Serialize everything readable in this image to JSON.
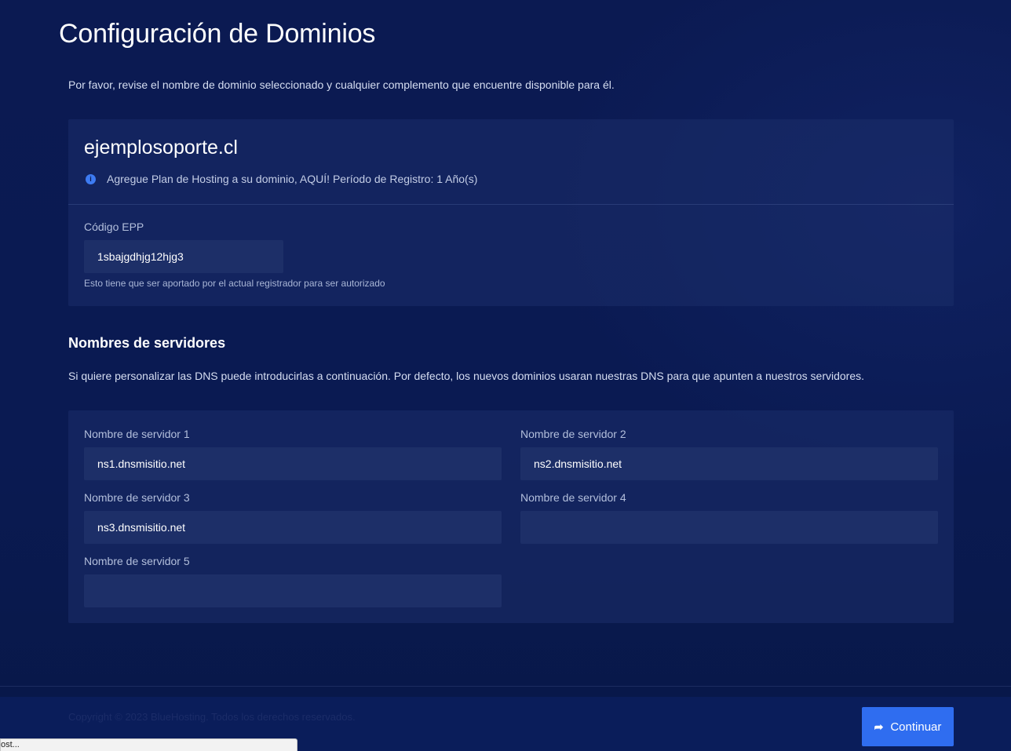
{
  "page": {
    "title": "Configuración de Dominios",
    "intro": "Por favor, revise el nombre de dominio seleccionado y cualquier complemento que encuentre disponible para él."
  },
  "domain": {
    "name": "ejemplosoporte.cl",
    "info_icon": "info-circle-icon",
    "info_text": "Agregue Plan de Hosting a su dominio, AQUÍ! Período de Registro: 1 Año(s)",
    "epp_label": "Código EPP",
    "epp_value": "1sbajgdhjg12hjg3",
    "epp_help": "Esto tiene que ser aportado por el actual registrador para ser autorizado"
  },
  "nameservers": {
    "title": "Nombres de servidores",
    "description": "Si quiere personalizar las DNS puede introducirlas a continuación. Por defecto, los nuevos dominios usaran nuestras DNS para que apunten a nuestros servidores.",
    "fields": [
      {
        "label": "Nombre de servidor 1",
        "value": "ns1.dnsmisitio.net"
      },
      {
        "label": "Nombre de servidor 2",
        "value": "ns2.dnsmisitio.net"
      },
      {
        "label": "Nombre de servidor 3",
        "value": "ns3.dnsmisitio.net"
      },
      {
        "label": "Nombre de servidor 4",
        "value": ""
      },
      {
        "label": "Nombre de servidor 5",
        "value": ""
      }
    ]
  },
  "footer": {
    "copyright": "Copyright © 2023 BlueHosting. Todos los derechos reservados.",
    "continue_label": "Continuar",
    "continue_icon": "share-arrow-icon"
  },
  "browser_status": {
    "text": "ost..."
  },
  "colors": {
    "background": "#0b1a52",
    "card": "#1b2d69",
    "input": "#1d2f68",
    "accent": "#2f6df0"
  }
}
